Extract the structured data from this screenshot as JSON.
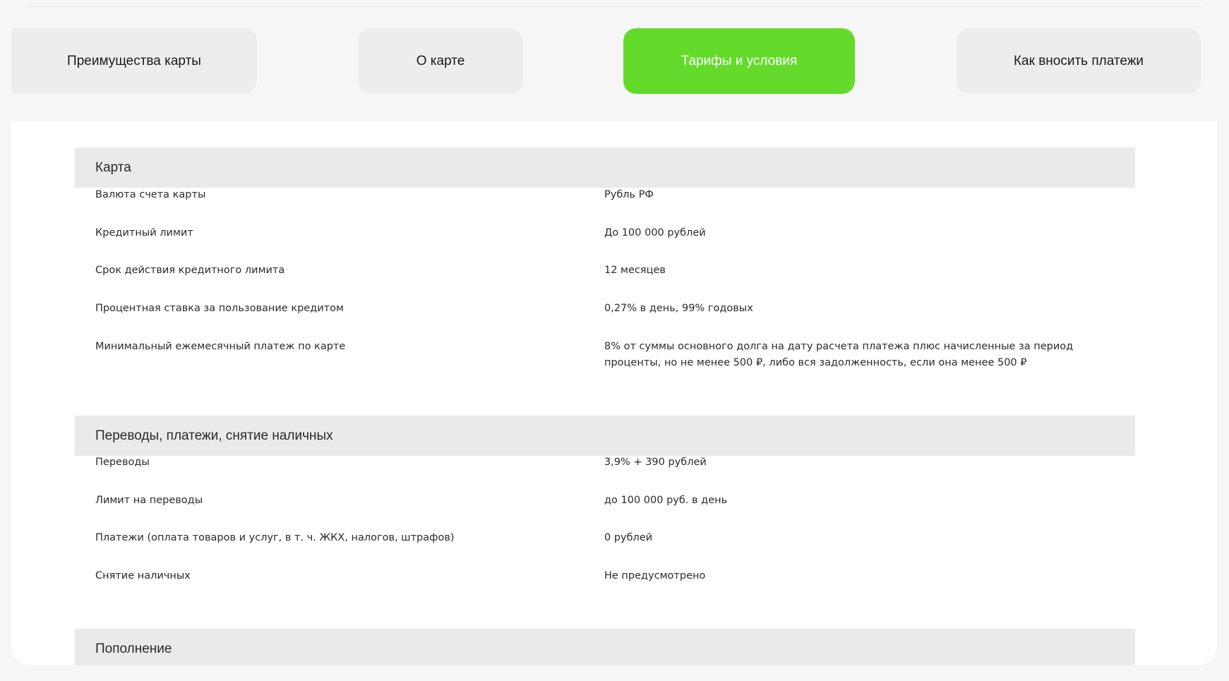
{
  "tabs": [
    {
      "label": "Преимущества карты",
      "active": false
    },
    {
      "label": "О карте",
      "active": false
    },
    {
      "label": "Тарифы и условия",
      "active": true
    },
    {
      "label": "Как вносить платежи",
      "active": false
    }
  ],
  "colors": {
    "accent": "#64db2b",
    "section_header_bg": "#eaeaea",
    "tab_bg": "#ededed"
  },
  "sections": [
    {
      "title": "Карта",
      "rows": [
        {
          "label": "Валюта счета карты",
          "value": "Рубль РФ"
        },
        {
          "label": "Кредитный лимит",
          "value": "До 100 000 рублей"
        },
        {
          "label": "Срок действия кредитного лимита",
          "value": "12 месяцев"
        },
        {
          "label": "Процентная ставка за пользование кредитом",
          "value": "0,27% в день, 99% годовых"
        },
        {
          "label": "Минимальный ежемесячный платеж по карте",
          "value": "8% от суммы основного долга на дату расчета платежа плюс начисленные за период проценты, но не менее 500 ₽, либо вся задолженность, если она менее 500 ₽"
        }
      ]
    },
    {
      "title": "Переводы, платежи, снятие наличных",
      "rows": [
        {
          "label": "Переводы",
          "value": "3,9% + 390 рублей"
        },
        {
          "label": "Лимит на переводы",
          "value": "до 100 000 руб. в день"
        },
        {
          "label": "Платежи (оплата товаров и услуг, в т. ч. ЖКХ, налогов, штрафов)",
          "value": "0 рублей"
        },
        {
          "label": "Снятие наличных",
          "value": "Не предусмотрено"
        }
      ]
    },
    {
      "title": "Пополнение",
      "rows": []
    }
  ]
}
